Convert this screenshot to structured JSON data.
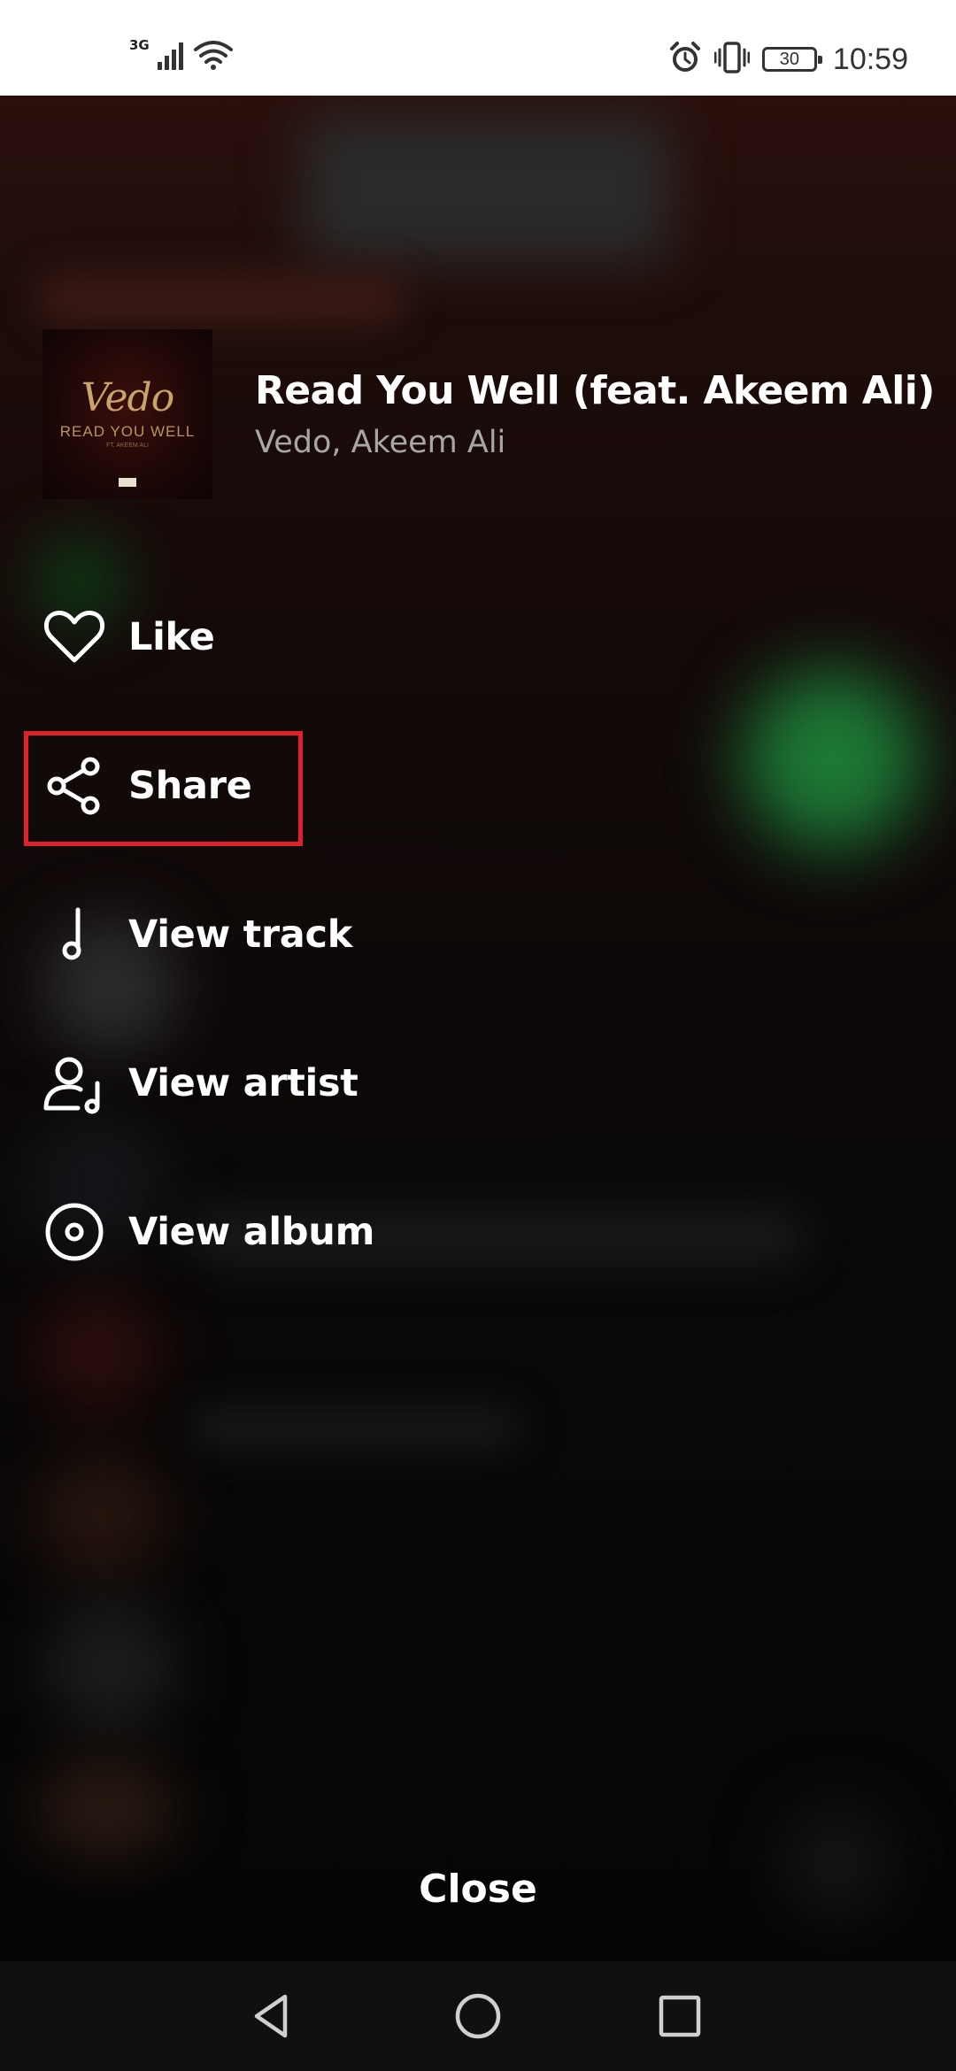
{
  "status_bar": {
    "network": "3G",
    "battery": "30",
    "time": "10:59"
  },
  "track": {
    "title": "Read You Well (feat. Akeem Ali)",
    "artists": "Vedo, Akeem Ali",
    "cover": {
      "artist_script": "Vedo",
      "title": "READ YOU WELL",
      "feat": "FT. AKEEM ALI"
    }
  },
  "menu": {
    "items": [
      {
        "label": "Like",
        "icon": "heart-icon"
      },
      {
        "label": "Share",
        "icon": "share-icon"
      },
      {
        "label": "View track",
        "icon": "music-note-icon"
      },
      {
        "label": "View artist",
        "icon": "artist-icon"
      },
      {
        "label": "View album",
        "icon": "album-icon"
      }
    ]
  },
  "close_label": "Close",
  "nav_bar": {
    "buttons": [
      "back-icon",
      "home-icon",
      "recents-icon"
    ]
  },
  "colors": {
    "highlight": "#e0202a",
    "text_primary": "#ffffff",
    "text_secondary": "#a7a7a7"
  }
}
